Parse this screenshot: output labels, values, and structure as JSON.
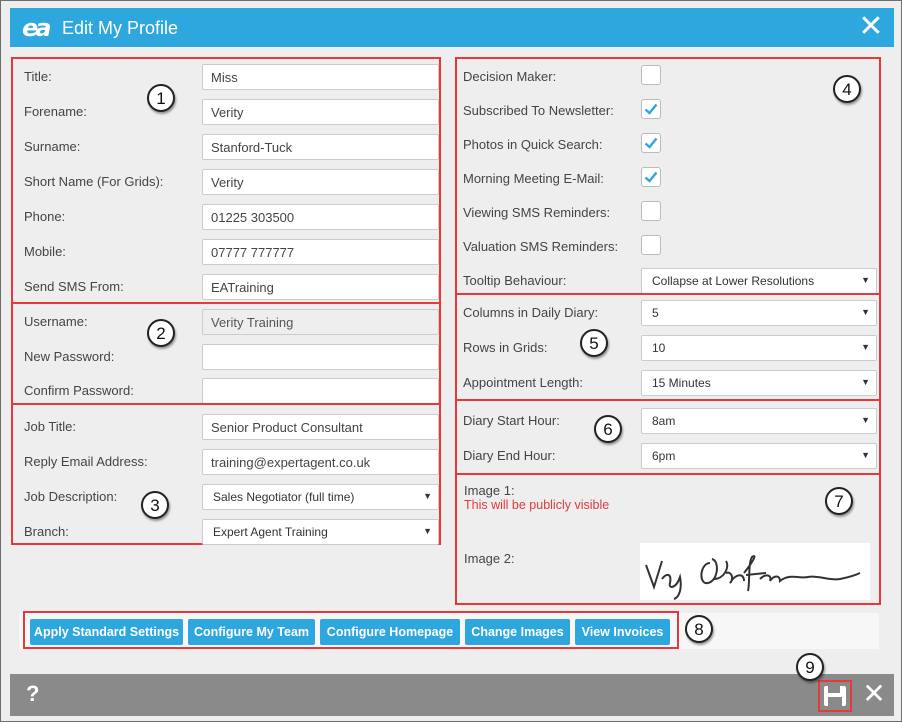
{
  "window": {
    "title": "Edit My Profile",
    "logo": "ea"
  },
  "personal": {
    "title": {
      "label": "Title:",
      "value": "Miss"
    },
    "forename": {
      "label": "Forename:",
      "value": "Verity"
    },
    "surname": {
      "label": "Surname:",
      "value": "Stanford-Tuck"
    },
    "short_name": {
      "label": "Short Name (For Grids):",
      "value": "Verity"
    },
    "phone": {
      "label": "Phone:",
      "value": "01225 303500"
    },
    "mobile": {
      "label": "Mobile:",
      "value": "07777 777777"
    },
    "send_sms_from": {
      "label": "Send SMS From:",
      "value": "EATraining"
    }
  },
  "login": {
    "username": {
      "label": "Username:",
      "value": "Verity Training"
    },
    "new_password": {
      "label": "New Password:",
      "value": ""
    },
    "confirm_password": {
      "label": "Confirm Password:",
      "value": ""
    }
  },
  "job": {
    "job_title": {
      "label": "Job Title:",
      "value": "Senior Product Consultant"
    },
    "reply_email": {
      "label": "Reply Email Address:",
      "value": "training@expertagent.co.uk"
    },
    "job_description": {
      "label": "Job Description:",
      "value": "Sales Negotiator (full time)"
    },
    "branch": {
      "label": "Branch:",
      "value": "Expert Agent Training"
    }
  },
  "preferences": {
    "decision_maker": {
      "label": "Decision Maker:",
      "checked": false
    },
    "newsletter": {
      "label": "Subscribed To Newsletter:",
      "checked": true
    },
    "photos_quick_search": {
      "label": "Photos in Quick Search:",
      "checked": true
    },
    "morning_meeting": {
      "label": "Morning Meeting E-Mail:",
      "checked": true
    },
    "viewing_sms": {
      "label": "Viewing SMS Reminders:",
      "checked": false
    },
    "valuation_sms": {
      "label": "Valuation SMS Reminders:",
      "checked": false
    },
    "tooltip": {
      "label": "Tooltip Behaviour:",
      "value": "Collapse at Lower Resolutions"
    }
  },
  "grids": {
    "columns_diary": {
      "label": "Columns in Daily Diary:",
      "value": "5"
    },
    "rows_grids": {
      "label": "Rows in Grids:",
      "value": "10"
    },
    "appointment_length": {
      "label": "Appointment Length:",
      "value": "15 Minutes"
    }
  },
  "diary": {
    "start_hour": {
      "label": "Diary Start Hour:",
      "value": "8am"
    },
    "end_hour": {
      "label": "Diary End Hour:",
      "value": "6pm"
    }
  },
  "images": {
    "image1": {
      "label": "Image 1:",
      "note": "This will be publicly visible"
    },
    "image2": {
      "label": "Image 2:"
    }
  },
  "buttons": {
    "apply_standard": "Apply Standard Settings",
    "configure_team": "Configure My Team",
    "configure_homepage": "Configure Homepage",
    "change_images": "Change Images",
    "view_invoices": "View Invoices"
  },
  "footer": {
    "help": "?",
    "save_icon": "floppy-disk-icon",
    "close_icon": "close-icon"
  },
  "badges": [
    "1",
    "2",
    "3",
    "4",
    "5",
    "6",
    "7",
    "8",
    "9"
  ],
  "colors": {
    "accent": "#2ea6de",
    "highlight": "#e5393b",
    "footer": "#8a8a8a"
  }
}
